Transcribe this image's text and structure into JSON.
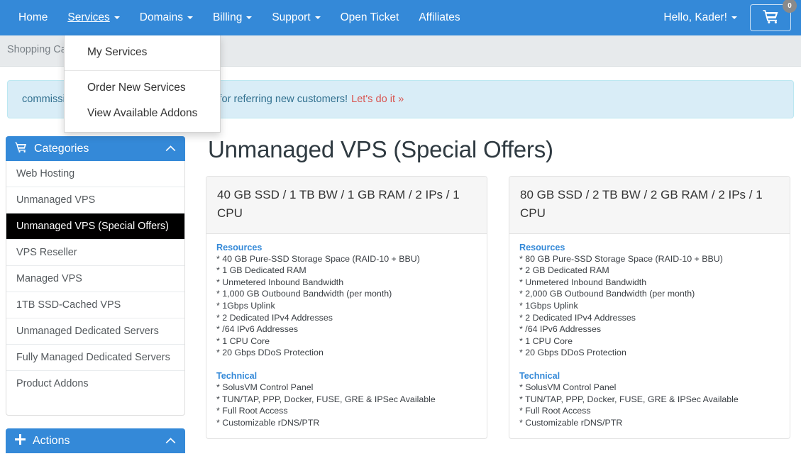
{
  "navbar": {
    "items": [
      {
        "label": "Home",
        "caret": false,
        "open": false
      },
      {
        "label": "Services",
        "caret": true,
        "open": true
      },
      {
        "label": "Domains",
        "caret": true,
        "open": false
      },
      {
        "label": "Billing",
        "caret": true,
        "open": false
      },
      {
        "label": "Support",
        "caret": true,
        "open": false
      },
      {
        "label": "Open Ticket",
        "caret": false,
        "open": false
      },
      {
        "label": "Affiliates",
        "caret": false,
        "open": false
      }
    ],
    "greeting": "Hello, Kader!",
    "cart_count": "0",
    "cart_icon": "shopping-cart-icon",
    "brand_color": "#3489d8"
  },
  "services_dropdown": {
    "items_top": [
      "My Services"
    ],
    "items_bottom": [
      "Order New Services",
      "View Available Addons"
    ]
  },
  "breadcrumb": {
    "text": "Shopping Cart"
  },
  "alert": {
    "text": "commission (with a $10 enrollment bonus) for referring new customers!",
    "link": "Let's do it »",
    "link_color": "#d9534f",
    "bg_color": "#d9edf7"
  },
  "sidebar": {
    "categories": {
      "title": "Categories",
      "icon": "shopping-cart-icon",
      "chevron": "chevron-up-icon",
      "items": [
        {
          "label": "Web Hosting",
          "active": false
        },
        {
          "label": "Unmanaged VPS",
          "active": false
        },
        {
          "label": "Unmanaged VPS (Special Offers)",
          "active": true
        },
        {
          "label": "VPS Reseller",
          "active": false
        },
        {
          "label": "Managed VPS",
          "active": false
        },
        {
          "label": "1TB SSD-Cached VPS",
          "active": false
        },
        {
          "label": "Unmanaged Dedicated Servers",
          "active": false
        },
        {
          "label": "Fully Managed Dedicated Servers",
          "active": false
        },
        {
          "label": "Product Addons",
          "active": false
        }
      ]
    },
    "actions": {
      "title": "Actions",
      "icon": "plus-icon",
      "chevron": "chevron-up-icon"
    }
  },
  "main": {
    "title": "Unmanaged VPS (Special Offers)",
    "products": [
      {
        "name": "40 GB SSD / 1 TB BW / 1 GB RAM / 2 IPs / 1 CPU",
        "sections": [
          {
            "heading": "Resources",
            "lines": [
              "* 40 GB Pure-SSD Storage Space (RAID-10 + BBU)",
              "* 1 GB Dedicated RAM",
              "* Unmetered Inbound Bandwidth",
              "* 1,000 GB Outbound Bandwidth (per month)",
              "* 1Gbps Uplink",
              "* 2 Dedicated IPv4 Addresses",
              "* /64 IPv6 Addresses",
              "* 1 CPU Core",
              "* 20 Gbps DDoS Protection"
            ]
          },
          {
            "heading": "Technical",
            "lines": [
              "* SolusVM Control Panel",
              "* TUN/TAP, PPP, Docker, FUSE, GRE & IPSec Available",
              "* Full Root Access",
              "* Customizable rDNS/PTR"
            ]
          }
        ]
      },
      {
        "name": "80 GB SSD / 2 TB BW / 2 GB RAM / 2 IPs / 1 CPU",
        "sections": [
          {
            "heading": "Resources",
            "lines": [
              "* 80 GB Pure-SSD Storage Space (RAID-10 + BBU)",
              "* 2 GB Dedicated RAM",
              "* Unmetered Inbound Bandwidth",
              "* 2,000 GB Outbound Bandwidth (per month)",
              "* 1Gbps Uplink",
              "* 2 Dedicated IPv4 Addresses",
              "* /64 IPv6 Addresses",
              "* 1 CPU Core",
              "* 20 Gbps DDoS Protection"
            ]
          },
          {
            "heading": "Technical",
            "lines": [
              "* SolusVM Control Panel",
              "* TUN/TAP, PPP, Docker, FUSE, GRE & IPSec Available",
              "* Full Root Access",
              "* Customizable rDNS/PTR"
            ]
          }
        ]
      }
    ]
  }
}
